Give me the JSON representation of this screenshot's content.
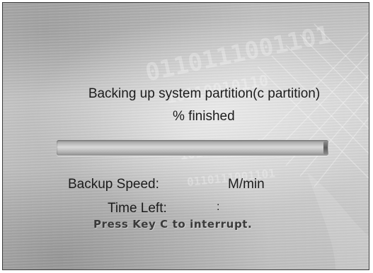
{
  "backup_dialog": {
    "title": "Backing up system partition(c partition)",
    "progress_text": "% finished",
    "progress_fraction": 0,
    "speed_label": "Backup Speed:",
    "speed_unit": "M/min",
    "time_left_label": "Time Left:",
    "time_left_separator": ":",
    "interrupt_hint": "Press  Key C to interrupt."
  },
  "background": {
    "decoration_text": "0110111001101",
    "decoration_text_2": "10110010110"
  }
}
